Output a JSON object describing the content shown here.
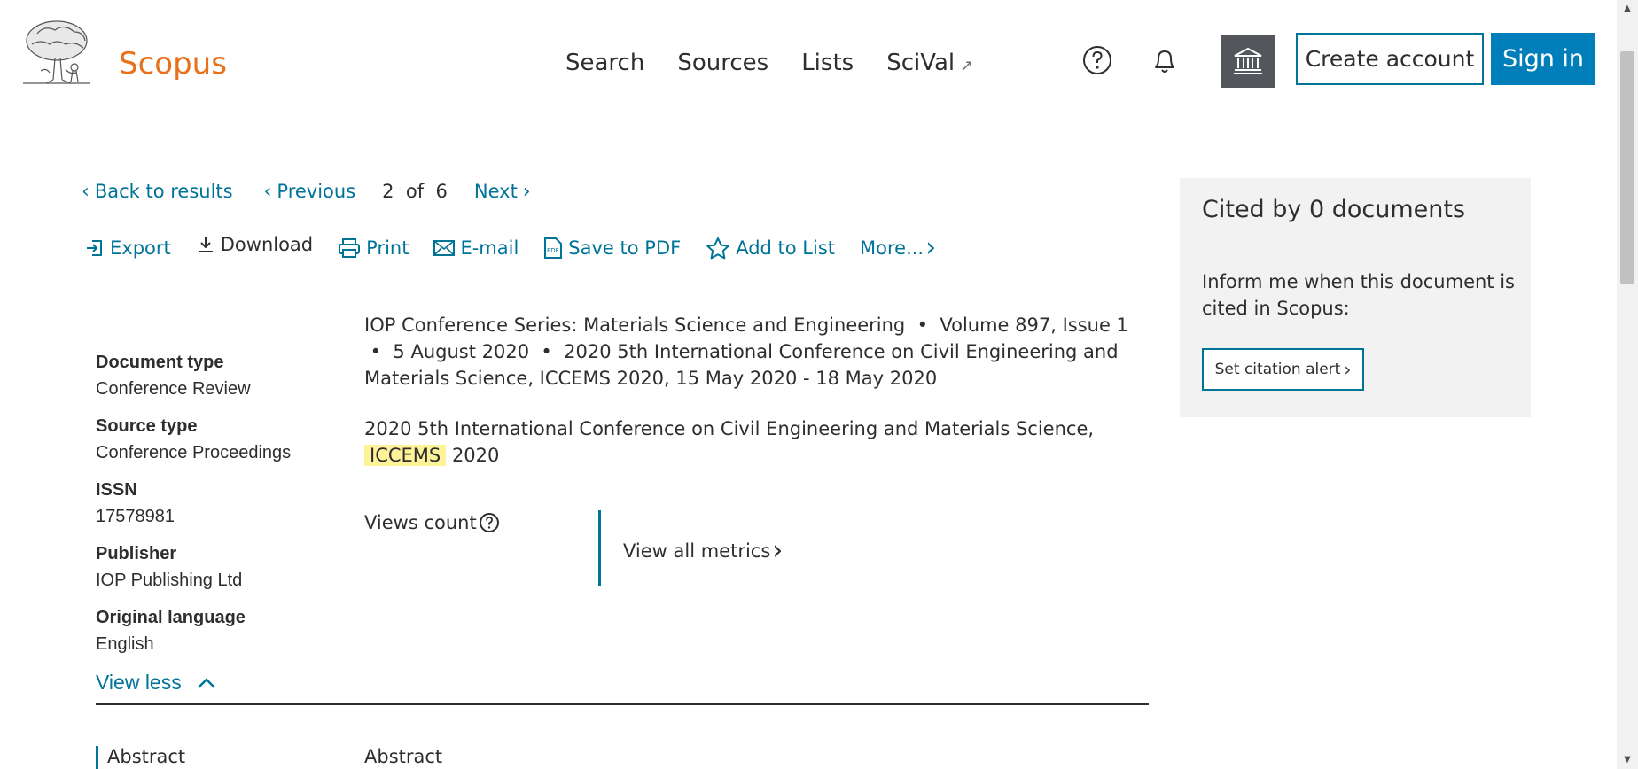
{
  "header": {
    "brand": "Scopus",
    "nav": [
      {
        "label": "Search"
      },
      {
        "label": "Sources"
      },
      {
        "label": "Lists"
      },
      {
        "label": "SciVal"
      }
    ],
    "external_glyph": "↗",
    "create_account": "Create account",
    "sign_in": "Sign in"
  },
  "pager": {
    "back": "Back to results",
    "previous": "Previous",
    "current": "2",
    "of": "of",
    "total": "6",
    "next": "Next"
  },
  "actions": {
    "export": "Export",
    "download": "Download",
    "print": "Print",
    "email": "E-mail",
    "save_pdf": "Save to PDF",
    "add_list": "Add to List",
    "more": "More..."
  },
  "metadata": {
    "document_type_label": "Document type",
    "document_type": "Conference Review",
    "source_type_label": "Source type",
    "source_type": "Conference Proceedings",
    "issn_label": "ISSN",
    "issn": "17578981",
    "publisher_label": "Publisher",
    "publisher": "IOP Publishing Ltd",
    "language_label": "Original language",
    "language": "English"
  },
  "source": {
    "journal": "IOP Conference Series: Materials Science and Engineering",
    "volume": "Volume 897, Issue 1",
    "date": "5 August 2020",
    "conference_full": "2020 5th International Conference on Civil Engineering and Materials Science, ICCEMS 2020, 15 May 2020 - 18 May 2020"
  },
  "conference": {
    "name_prefix": "2020 5th International Conference on Civil Engineering and Materials Science,",
    "highlight": "ICCEMS",
    "year": "2020"
  },
  "metrics": {
    "views_count": "Views count",
    "view_all": "View all metrics"
  },
  "view_less": "View less",
  "abstract": {
    "nav_label": "Abstract",
    "title": "Abstract"
  },
  "sidebar": {
    "cited_by": "Cited by 0 documents",
    "inform": "Inform me when this document is cited in Scopus:",
    "alert_button": "Set citation alert"
  },
  "colors": {
    "brand_orange": "#e9711c",
    "link_blue": "#007398",
    "signin_blue": "#007eb9",
    "highlight_yellow": "#fff399"
  }
}
